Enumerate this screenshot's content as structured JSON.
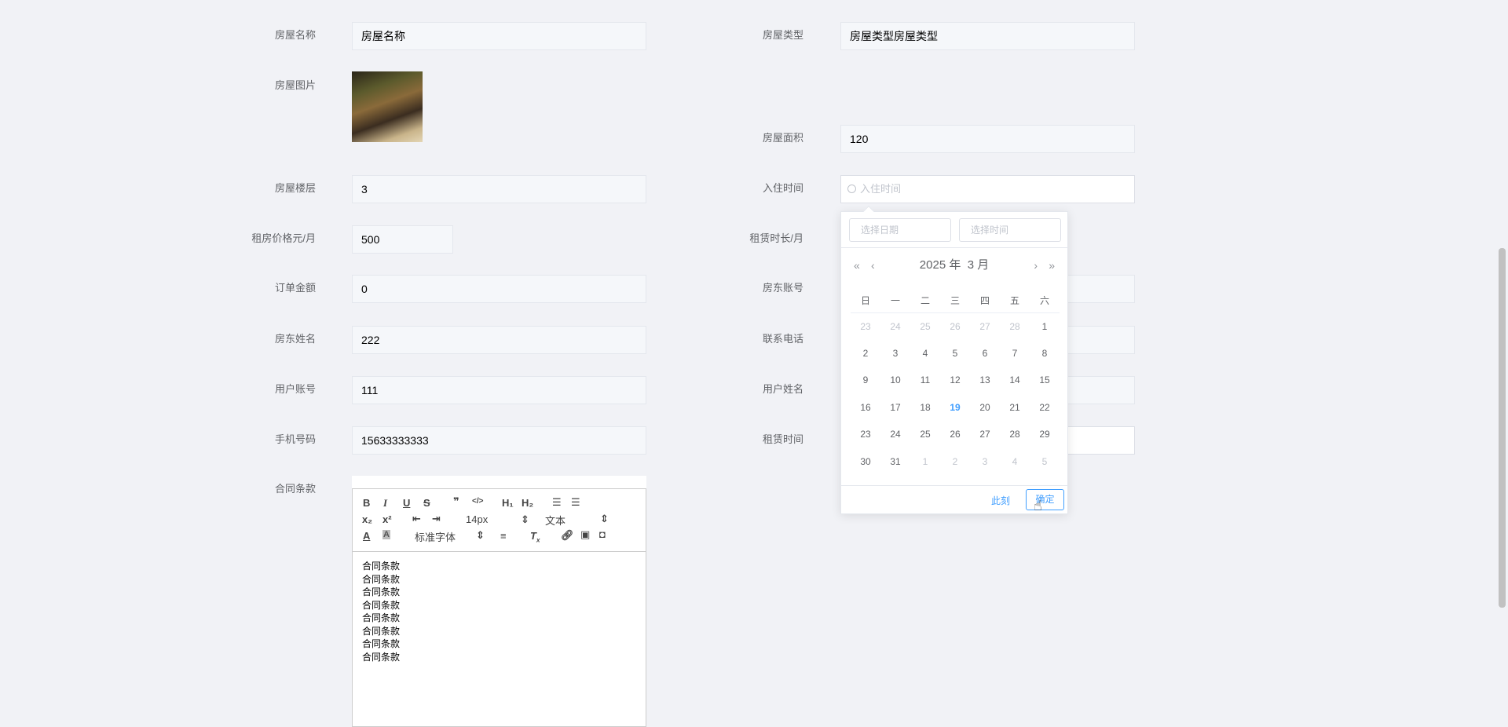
{
  "left": [
    {
      "label": "房屋名称",
      "value": "房屋名称"
    },
    {
      "label": "房屋图片"
    },
    {
      "label": "房屋楼层",
      "value": "3"
    },
    {
      "label": "租房价格元/月",
      "value": "500"
    },
    {
      "label": "订单金额",
      "value": "0"
    },
    {
      "label": "房东姓名",
      "value": "222"
    },
    {
      "label": "用户账号",
      "value": "111"
    },
    {
      "label": "手机号码",
      "value": "15633333333"
    },
    {
      "label": "合同条款"
    }
  ],
  "right": [
    {
      "label": "房屋类型",
      "value": "房屋类型房屋类型"
    },
    {
      "label": "房屋面积",
      "value": "120"
    },
    {
      "label": "入住时间",
      "placeholder": "入住时间",
      "icon": "clock-icon"
    },
    {
      "label": "租赁时长/月"
    },
    {
      "label": "房东账号"
    },
    {
      "label": "联系电话"
    },
    {
      "label": "用户姓名"
    },
    {
      "label": "租赁时间"
    }
  ],
  "picker": {
    "date_placeholder": "选择日期",
    "time_placeholder": "选择时间",
    "year": "2025 年",
    "month": "3 月",
    "weekdays": [
      "日",
      "一",
      "二",
      "三",
      "四",
      "五",
      "六"
    ],
    "weeks": [
      [
        "23",
        "24",
        "25",
        "26",
        "27",
        "28",
        "1"
      ],
      [
        "2",
        "3",
        "4",
        "5",
        "6",
        "7",
        "8"
      ],
      [
        "9",
        "10",
        "11",
        "12",
        "13",
        "14",
        "15"
      ],
      [
        "16",
        "17",
        "18",
        "19",
        "20",
        "21",
        "22"
      ],
      [
        "23",
        "24",
        "25",
        "26",
        "27",
        "28",
        "29"
      ],
      [
        "30",
        "31",
        "1",
        "2",
        "3",
        "4",
        "5"
      ]
    ],
    "today": "19",
    "now_label": "此刻",
    "ok_label": "确定",
    "accent": "#409eff"
  },
  "editor": {
    "font_size": "14px",
    "block": "文本",
    "font": "标准字体",
    "lines": [
      "合同条款",
      "合同条款",
      "合同条款",
      "合同条款",
      "合同条款",
      "合同条款",
      "合同条款",
      "合同条款"
    ]
  }
}
